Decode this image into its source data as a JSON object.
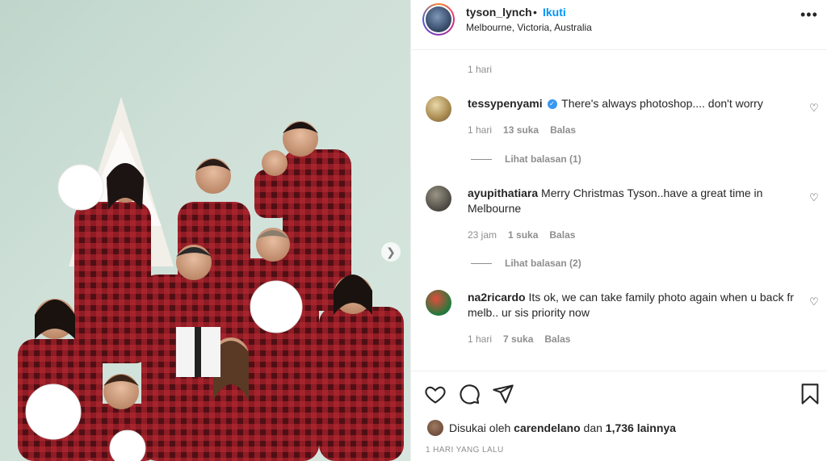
{
  "post": {
    "username": "tyson_lynch",
    "separator": "•",
    "follow_label": "Ikuti",
    "location": "Melbourne, Victoria, Australia",
    "more_glyph": "•••",
    "caption_time": "1 hari"
  },
  "comments": [
    {
      "username": "tessypenyami",
      "verified": true,
      "text": "There's always photoshop.... don't worry",
      "time": "1 hari",
      "likes": "13 suka",
      "reply_label": "Balas",
      "view_replies": "Lihat balasan (1)"
    },
    {
      "username": "ayupithatiara",
      "verified": false,
      "text": "Merry Christmas Tyson..have a great time in Melbourne",
      "time": "23 jam",
      "likes": "1 suka",
      "reply_label": "Balas",
      "view_replies": "Lihat balasan (2)"
    },
    {
      "username": "na2ricardo",
      "verified": false,
      "text": "Its ok, we can take family photo again when u back fr melb.. ur sis priority now",
      "time": "1 hari",
      "likes": "7 suka",
      "reply_label": "Balas"
    }
  ],
  "footer": {
    "liked_by_prefix": "Disukai oleh",
    "liked_by_user": "carendelano",
    "liked_by_and": "dan",
    "liked_by_count": "1,736 lainnya",
    "timestamp": "1 HARI YANG LALU"
  },
  "icons": {
    "like": "heart-icon",
    "comment": "comment-icon",
    "share": "share-icon",
    "save": "bookmark-icon",
    "next": "chevron-right-icon",
    "verified": "verified-badge-icon"
  },
  "colors": {
    "accent": "#0095f6",
    "text": "#262626",
    "muted": "#8e8e8e",
    "verified": "#3897f0",
    "pajama_red": "#8f1c24"
  }
}
